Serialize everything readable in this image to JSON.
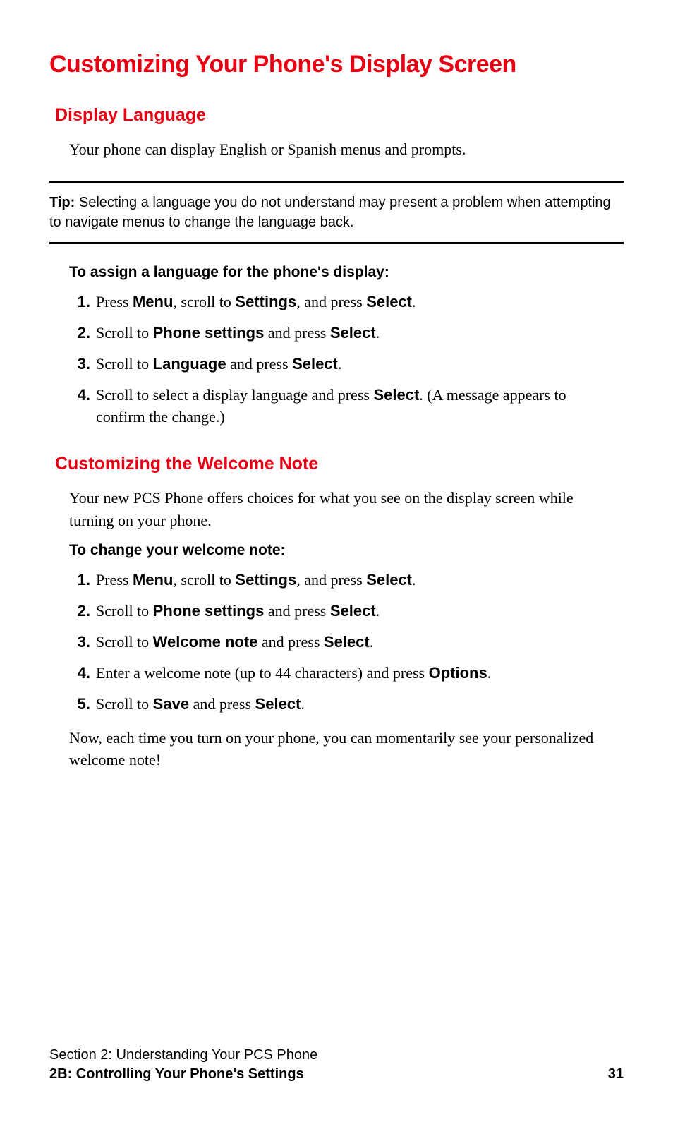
{
  "title": "Customizing Your Phone's Display Screen",
  "sections": [
    {
      "heading": "Display Language",
      "intro": "Your phone can display English or Spanish menus and prompts.",
      "tip_label": "Tip:",
      "tip_text": " Selecting a language you do not understand may present a problem when attempting to navigate menus to change the language back.",
      "subhead": "To assign a language for the phone's display:",
      "steps": [
        {
          "n": "1.",
          "parts": [
            "Press ",
            {
              "b": "Menu"
            },
            ", scroll to ",
            {
              "b": "Settings"
            },
            ", and press ",
            {
              "b": "Select"
            },
            "."
          ]
        },
        {
          "n": "2.",
          "parts": [
            "Scroll to ",
            {
              "b": "Phone settings"
            },
            " and press ",
            {
              "b": "Select"
            },
            "."
          ]
        },
        {
          "n": "3.",
          "parts": [
            "Scroll to ",
            {
              "b": "Language"
            },
            " and press ",
            {
              "b": "Select"
            },
            "."
          ]
        },
        {
          "n": "4.",
          "parts": [
            "Scroll to select a display language and press ",
            {
              "b": "Select"
            },
            ". (A message appears to confirm the change.)"
          ]
        }
      ]
    },
    {
      "heading": "Customizing the Welcome Note",
      "intro": "Your new PCS Phone offers choices for what you see on the display screen while turning on your phone.",
      "subhead": "To change your welcome note:",
      "steps": [
        {
          "n": "1.",
          "parts": [
            "Press ",
            {
              "b": "Menu"
            },
            ", scroll to ",
            {
              "b": "Settings"
            },
            ", and press ",
            {
              "b": "Select"
            },
            "."
          ]
        },
        {
          "n": "2.",
          "parts": [
            "Scroll to ",
            {
              "b": "Phone settings"
            },
            " and press ",
            {
              "b": "Select"
            },
            "."
          ]
        },
        {
          "n": "3.",
          "parts": [
            "Scroll to ",
            {
              "b": "Welcome note"
            },
            " and press ",
            {
              "b": "Select"
            },
            "."
          ]
        },
        {
          "n": "4.",
          "parts": [
            "Enter a welcome note (up to 44 characters) and press ",
            {
              "b": "Options"
            },
            "."
          ]
        },
        {
          "n": "5.",
          "parts": [
            "Scroll to ",
            {
              "b": "Save"
            },
            " and press ",
            {
              "b": "Select"
            },
            "."
          ]
        }
      ],
      "outro": "Now, each time you turn on your phone, you can momentarily see your personalized welcome note!"
    }
  ],
  "footer": {
    "line1": "Section 2: Understanding Your PCS Phone",
    "line2": "2B: Controlling Your Phone's Settings",
    "page": "31"
  }
}
